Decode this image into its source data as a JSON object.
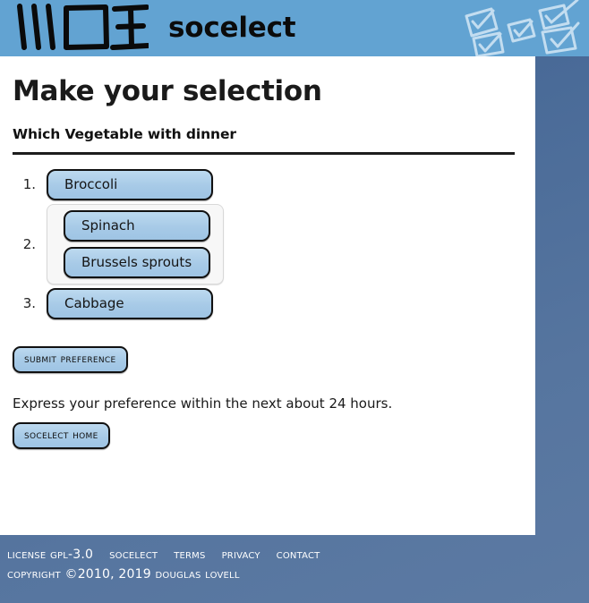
{
  "header": {
    "brand_name": "socelect",
    "logo_icon": "tally-marks-logo",
    "decoration_icon": "sketched-checkboxes"
  },
  "main": {
    "title": "Make your selection",
    "question": "Which Vegetable with dinner",
    "ranks": [
      {
        "number": "1.",
        "tied": false,
        "options": [
          "Broccoli"
        ]
      },
      {
        "number": "2.",
        "tied": true,
        "options": [
          "Spinach",
          "Brussels sprouts"
        ]
      },
      {
        "number": "3.",
        "tied": false,
        "options": [
          "Cabbage"
        ]
      }
    ],
    "submit_label": "Submit preference",
    "notice": "Express your preference within the next about 24 hours.",
    "home_label": "Socelect home"
  },
  "footer": {
    "links": [
      "License GPL-3.0",
      "socelect",
      "Terms",
      "Privacy",
      "Contact"
    ],
    "copyright": "Copyright ©2010, 2019 Douglas Lovell"
  },
  "colors": {
    "header_blue": "#62a3d2",
    "page_background": "#4a6b98",
    "pill_blue": "#a7cae7",
    "content_white": "#ffffff"
  }
}
